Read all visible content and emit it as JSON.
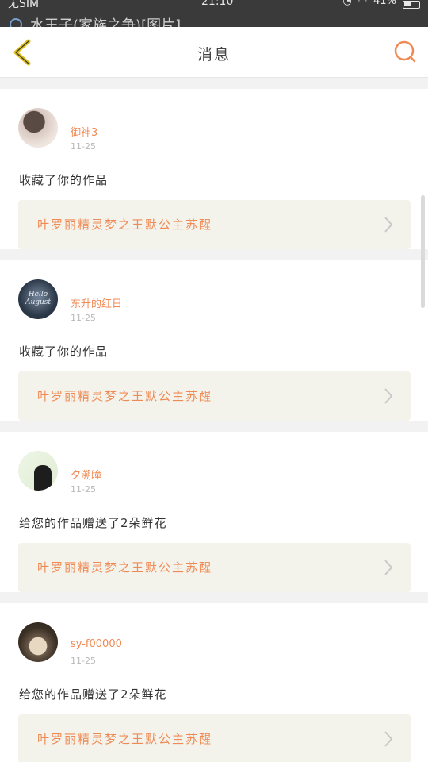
{
  "status_bar": {
    "carrier": "无SIM",
    "time": "21:10",
    "battery": "41%"
  },
  "notification": {
    "text": "水王子(家族之争)[图片]"
  },
  "header": {
    "title": "消息"
  },
  "messages": [
    {
      "username": "御神3",
      "date": "11-25",
      "action": "收藏了你的作品",
      "work": "叶罗丽精灵梦之王默公主苏醒"
    },
    {
      "username": "东升的红日",
      "date": "11-25",
      "action": "收藏了你的作品",
      "work": "叶罗丽精灵梦之王默公主苏醒",
      "avatar_text": "Hello August"
    },
    {
      "username": "夕溯瞳",
      "date": "11-25",
      "action": "给您的作品赠送了2朵鲜花",
      "work": "叶罗丽精灵梦之王默公主苏醒"
    },
    {
      "username": "sy-f00000",
      "date": "11-25",
      "action": "给您的作品赠送了2朵鲜花",
      "work": "叶罗丽精灵梦之王默公主苏醒"
    }
  ],
  "colors": {
    "accent": "#f08a54",
    "back_icon": "#e0c020",
    "card_link_bg": "#f3f3ec"
  },
  "icons": {
    "back": "chevron-left-icon",
    "search": "search-icon",
    "link": "chevron-right-icon"
  }
}
